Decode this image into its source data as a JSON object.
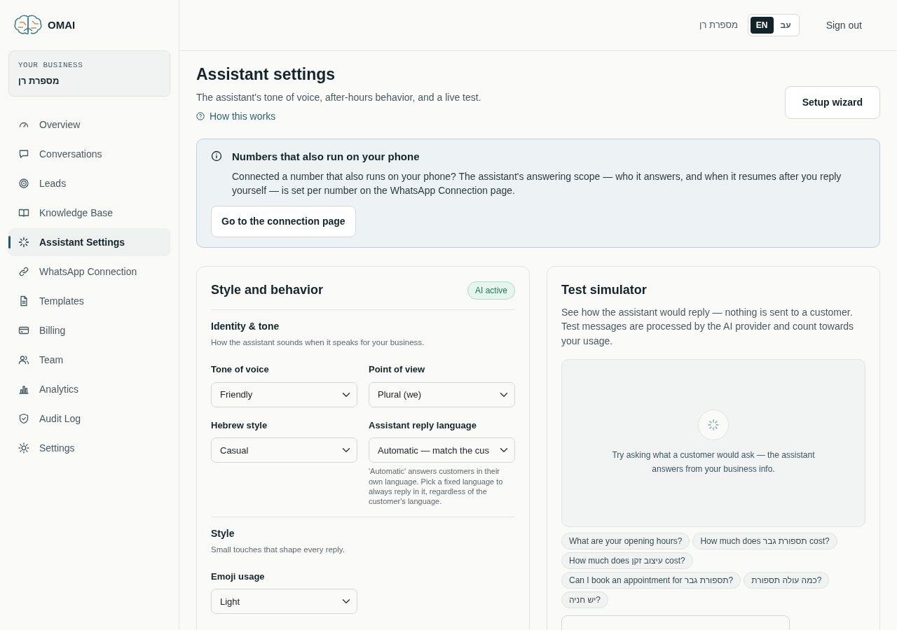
{
  "brand": {
    "name": "OMAI"
  },
  "business": {
    "label": "YOUR BUSINESS",
    "name": "מספרת רן"
  },
  "nav": [
    {
      "label": "Overview",
      "selected": false
    },
    {
      "label": "Conversations",
      "selected": false
    },
    {
      "label": "Leads",
      "selected": false
    },
    {
      "label": "Knowledge Base",
      "selected": false
    },
    {
      "label": "Assistant Settings",
      "selected": true
    },
    {
      "label": "WhatsApp Connection",
      "selected": false
    },
    {
      "label": "Templates",
      "selected": false
    },
    {
      "label": "Billing",
      "selected": false
    },
    {
      "label": "Team",
      "selected": false
    },
    {
      "label": "Analytics",
      "selected": false
    },
    {
      "label": "Audit Log",
      "selected": false
    },
    {
      "label": "Settings",
      "selected": false
    }
  ],
  "topbar": {
    "business_name": "מספרת רן",
    "languages": [
      {
        "label": "EN",
        "selected": true
      },
      {
        "label": "עב",
        "selected": false
      }
    ],
    "sign_out": "Sign out"
  },
  "page": {
    "title": "Assistant settings",
    "subtitle": "The assistant's tone of voice, after-hours behavior, and a live test.",
    "help_link": "How this works",
    "setup_button": "Setup wizard"
  },
  "notice": {
    "title": "Numbers that also run on your phone",
    "text": "Connected a number that also runs on your phone? The assistant's answering scope — who it answers, and when it resumes after you reply yourself — is set per number on the WhatsApp Connection page.",
    "button": "Go to the connection page"
  },
  "style_card": {
    "title": "Style and behavior",
    "badge": "AI active",
    "sections": [
      {
        "title": "Identity & tone",
        "hint": "How the assistant sounds when it speaks for your business.",
        "fields": [
          {
            "label": "Tone of voice",
            "value": "Friendly"
          },
          {
            "label": "Point of view",
            "value": "Plural (we)"
          },
          {
            "label": "Hebrew style",
            "value": "Casual"
          },
          {
            "label": "Assistant reply language",
            "value": "Automatic — match the cus",
            "help": "'Automatic' answers customers in their own language. Pick a fixed language to always reply in it, regardless of the customer's language."
          }
        ]
      },
      {
        "title": "Style",
        "hint": "Small touches that shape every reply.",
        "fields": [
          {
            "label": "Emoji usage",
            "value": "Light"
          }
        ]
      }
    ]
  },
  "simulator": {
    "title": "Test simulator",
    "text": "See how the assistant would reply — nothing is sent to a customer. Test messages are processed by the AI provider and count towards your usage.",
    "empty_text": "Try asking what a customer would ask — the assistant answers from your business info.",
    "suggestions": [
      [
        "What are your opening hours?",
        "How much does תספורת גבר cost?"
      ],
      [
        "How much does עיצוב זקן cost?"
      ],
      [
        "Can I book an appointment for תספורת גבר?",
        "כמה עולה תספורת?"
      ],
      [
        "יש חניה?"
      ]
    ]
  }
}
